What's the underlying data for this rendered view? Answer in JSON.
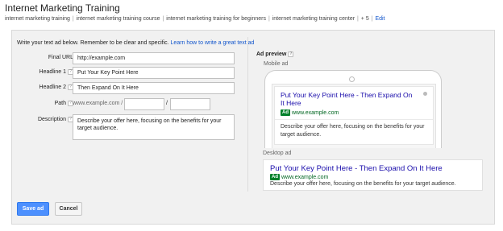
{
  "header": {
    "title": "Internet Marketing Training",
    "keywords": [
      "internet marketing training",
      "internet marketing training course",
      "internet marketing training for beginners",
      "internet marketing training center"
    ],
    "more_count": "+ 5",
    "edit_label": "Edit"
  },
  "form": {
    "intro_text": "Write your text ad below. Remember to be clear and specific.",
    "intro_link": "Learn how to write a great text ad",
    "final_url_label": "Final URL",
    "final_url_value": "http://example.com",
    "headline1_label": "Headline 1",
    "headline1_value": "Put Your Key Point Here",
    "headline2_label": "Headline 2",
    "headline2_value": "Then Expand On It Here",
    "path_label": "Path",
    "path_static": "www.example.com /",
    "path_sep": "/",
    "description_label": "Description",
    "description_value": "Describe your offer here, focusing on the benefits for your target audience.",
    "help_glyph": "?"
  },
  "preview": {
    "title": "Ad preview",
    "mobile_label": "Mobile ad",
    "desktop_label": "Desktop ad",
    "headline": "Put Your Key Point Here - Then Expand On It Here",
    "ad_badge": "Ad",
    "display_url": "www.example.com",
    "description": "Describe your offer here, focusing on the benefits for your target audience."
  },
  "buttons": {
    "save_label": "Save ad",
    "cancel_label": "Cancel"
  },
  "colors": {
    "link": "#1155cc",
    "headline": "#1a0dab",
    "url_green": "#006621",
    "primary_button": "#4d90fe"
  }
}
